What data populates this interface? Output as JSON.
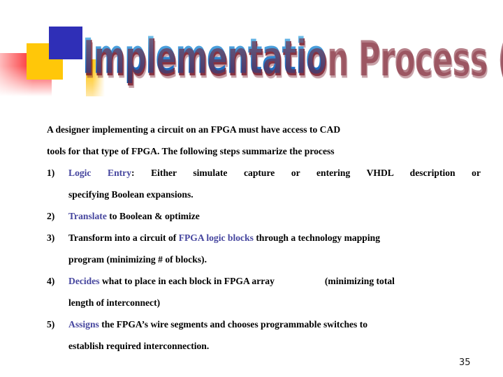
{
  "slide": {
    "title": "Implementation Process (overlook)",
    "page_number": "35",
    "colors": {
      "highlight": "#45459e",
      "title_light": "#9fd6f2",
      "title_dark": "#0b3f80",
      "title_shadow": "#7a1c2c",
      "deco_blue": "#2f2fb7",
      "deco_yellow": "#ffc709",
      "deco_pink": "#fb2c30",
      "body_text": "#000000",
      "background": "#ffffff"
    }
  },
  "intro": {
    "line1": "A designer implementing a circuit on an FPGA must have access to CAD",
    "line2": "tools for that type of FPGA. The following steps summarize the process"
  },
  "steps": [
    {
      "number": "1)",
      "highlight": "Logic Entry",
      "rest": ": Either simulate capture or entering VHDL description or",
      "continuation": "specifying Boolean expansions.",
      "justified": true
    },
    {
      "number": "2)",
      "highlight": "Translate",
      "rest": " to Boolean & optimize",
      "continuation": "",
      "justified": false
    },
    {
      "number": "3)",
      "pre": "Transform into a circuit of ",
      "highlight": "FPGA logic blocks",
      "rest": " through a technology mapping",
      "continuation": "program (minimizing # of blocks).",
      "justified": false
    },
    {
      "number": "4)",
      "highlight": "Decides",
      "rest": " what to place in each block in FPGA array",
      "tail": "(minimizing total",
      "continuation": "length of interconnect)",
      "justified": false
    },
    {
      "number": "5)",
      "highlight": "Assigns",
      "rest": " the FPGA’s wire segments and chooses programmable switches to",
      "continuation": "establish required interconnection.",
      "justified": false
    }
  ]
}
